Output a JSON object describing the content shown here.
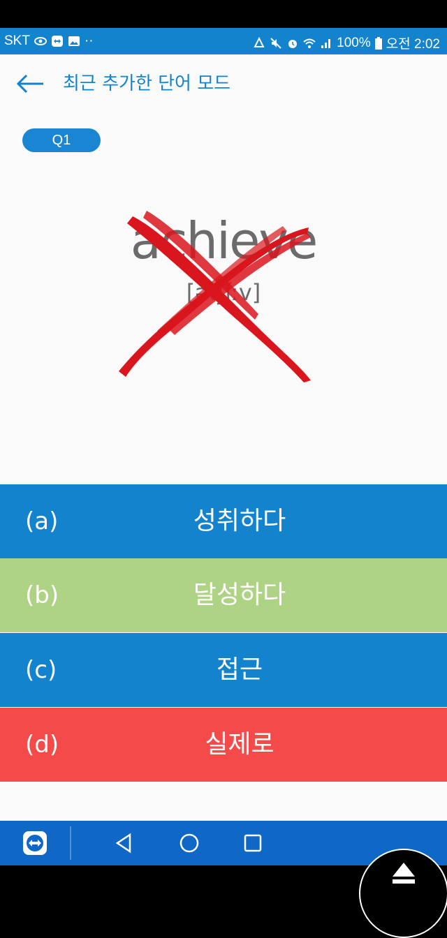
{
  "status_bar": {
    "carrier": "SKT",
    "dots": "··",
    "battery": "100%",
    "time": "오전 2:02"
  },
  "header": {
    "title": "최근 추가한 단어 모드"
  },
  "question": {
    "badge": "Q1",
    "word": "achieve",
    "pronunciation": "[ətʃíːv]"
  },
  "answers": [
    {
      "letter": "(a)",
      "text": "성취하다",
      "color": "#1483cd"
    },
    {
      "letter": "(b)",
      "text": "달성하다",
      "color": "#aed385"
    },
    {
      "letter": "(c)",
      "text": "접근",
      "color": "#1483cd"
    },
    {
      "letter": "(d)",
      "text": "실제로",
      "color": "#f44a4a"
    }
  ],
  "colors": {
    "accent": "#1483cd",
    "correct": "#aed385",
    "wrong": "#f44a4a",
    "x_mark": "#d9151d"
  }
}
